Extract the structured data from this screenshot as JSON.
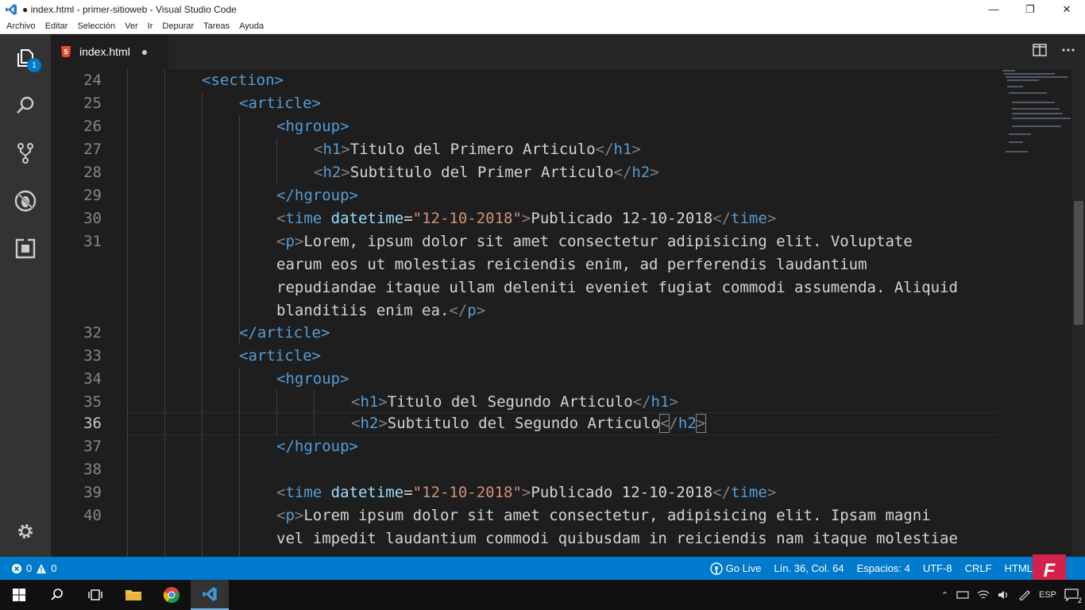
{
  "window": {
    "title": "● index.html - primer-sitioweb - Visual Studio Code",
    "controls": [
      "—",
      "❐",
      "✕"
    ]
  },
  "menu": [
    "Archivo",
    "Editar",
    "Selección",
    "Ver",
    "Ir",
    "Depurar",
    "Tareas",
    "Ayuda"
  ],
  "activity_bar": {
    "items": [
      "explorer-icon",
      "search-icon",
      "source-control-icon",
      "debug-icon",
      "extensions-icon"
    ],
    "explorer_badge": "1",
    "bottom": "gear-icon"
  },
  "tab": {
    "label": "index.html",
    "modified_dot": "●"
  },
  "tab_actions": [
    "split-editor-icon",
    "more-actions-icon"
  ],
  "editor": {
    "current_line": "36",
    "line_numbers": [
      "24",
      "25",
      "26",
      "27",
      "28",
      "29",
      "30",
      "31",
      "",
      "",
      "",
      "32",
      "33",
      "34",
      "35",
      "36",
      "37",
      "38",
      "39",
      "40",
      "",
      ""
    ],
    "code": {
      "l24": "<section>",
      "l25": "<article>",
      "l26": "<hgroup>",
      "l27_tag": "h1",
      "l27_text": "Titulo del Primero Articulo",
      "l28_tag": "h2",
      "l28_text": "Subtitulo del Primer Articulo",
      "l29": "</hgroup>",
      "l30_attr": "datetime",
      "l30_value": "\"12-10-2018\"",
      "l30_text": "Publicado 12-10-2018",
      "l31_a": "Lorem, ipsum dolor sit amet consectetur adipisicing elit. Voluptate",
      "l31_b": "earum eos ut molestias reiciendis enim, ad perferendis laudantium",
      "l31_c": "repudiandae itaque ullam deleniti eveniet fugiat commodi assumenda. Aliquid",
      "l31_d": "blanditiis enim ea.",
      "l32": "</article>",
      "l33": "<article>",
      "l34": "<hgroup>",
      "l35_tag": "h1",
      "l35_text": "Titulo del Segundo Articulo",
      "l36_tag": "h2",
      "l36_text": "Subtitulo del Segundo Articulo",
      "l37": "</hgroup>",
      "l39_attr": "datetime",
      "l39_value": "\"12-10-2018\"",
      "l39_text": "Publicado 12-10-2018",
      "l40_a": "Lorem ipsum dolor sit amet consectetur, adipisicing elit. Ipsam magni",
      "l40_b": "vel impedit laudantium commodi quibusdam in reiciendis nam itaque molestiae"
    }
  },
  "status_bar": {
    "errors": "0",
    "warnings": "0",
    "go_live": "Go Live",
    "position": "Lín. 36, Col. 64",
    "spaces": "Espacios: 4",
    "encoding": "UTF-8",
    "eol": "CRLF",
    "language": "HTML",
    "logo_letter": "F"
  },
  "taskbar": {
    "items": [
      "windows-start-icon",
      "search-icon",
      "task-view-icon",
      "file-explorer-icon",
      "chrome-icon",
      "vscode-icon"
    ],
    "language": "ESP",
    "notifications": "2"
  },
  "colors": {
    "accent": "#007acc",
    "editor_bg": "#1e1e1e",
    "tag": "#569cd6",
    "attr": "#9cdcfe",
    "string": "#ce9178"
  }
}
